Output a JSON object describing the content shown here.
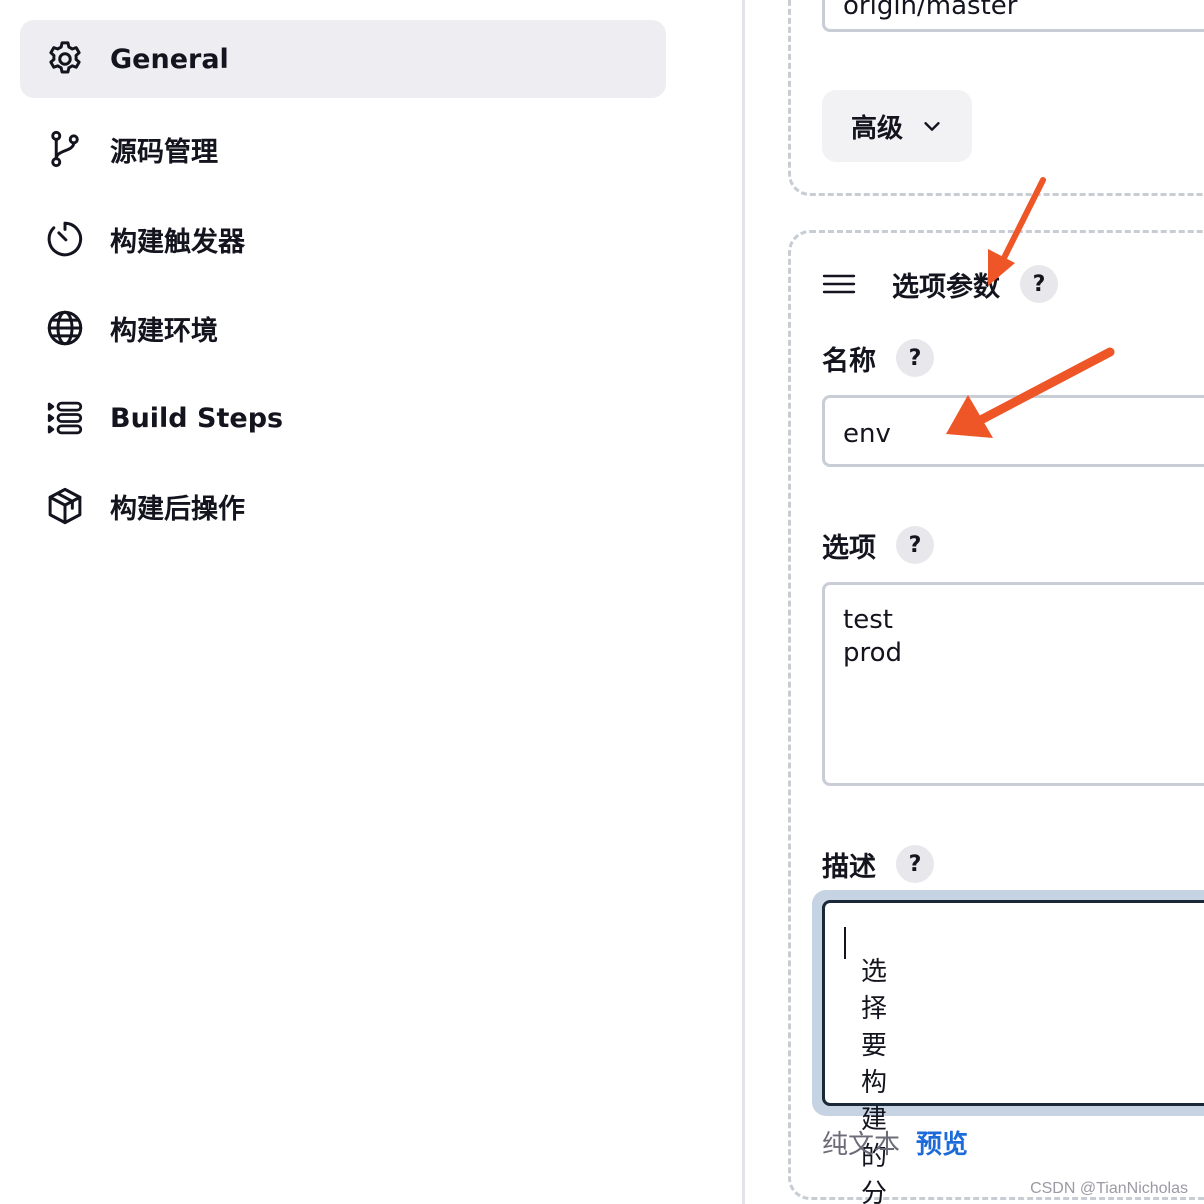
{
  "sidebar": {
    "items": [
      {
        "label": "General",
        "icon": "gear-icon",
        "active": true
      },
      {
        "label": "源码管理",
        "icon": "git-branch-icon"
      },
      {
        "label": "构建触发器",
        "icon": "timer-icon"
      },
      {
        "label": "构建环境",
        "icon": "globe-icon"
      },
      {
        "label": "Build Steps",
        "icon": "list-steps-icon"
      },
      {
        "label": "构建后操作",
        "icon": "package-icon"
      }
    ]
  },
  "scm": {
    "branch_value": "origin/master",
    "advanced_label": "高级"
  },
  "param": {
    "title": "选项参数",
    "help": "?",
    "name_label": "名称",
    "name_value": "env",
    "choices_label": "选项",
    "choices": [
      "test",
      "prod"
    ],
    "description_label": "描述",
    "description_value": "选择要构建的分支",
    "format_plain": "纯文本",
    "format_preview": "预览"
  },
  "annotation_color": "#ee5527",
  "accent_color": "#1c6bd8",
  "watermark": "CSDN @TianNicholas"
}
